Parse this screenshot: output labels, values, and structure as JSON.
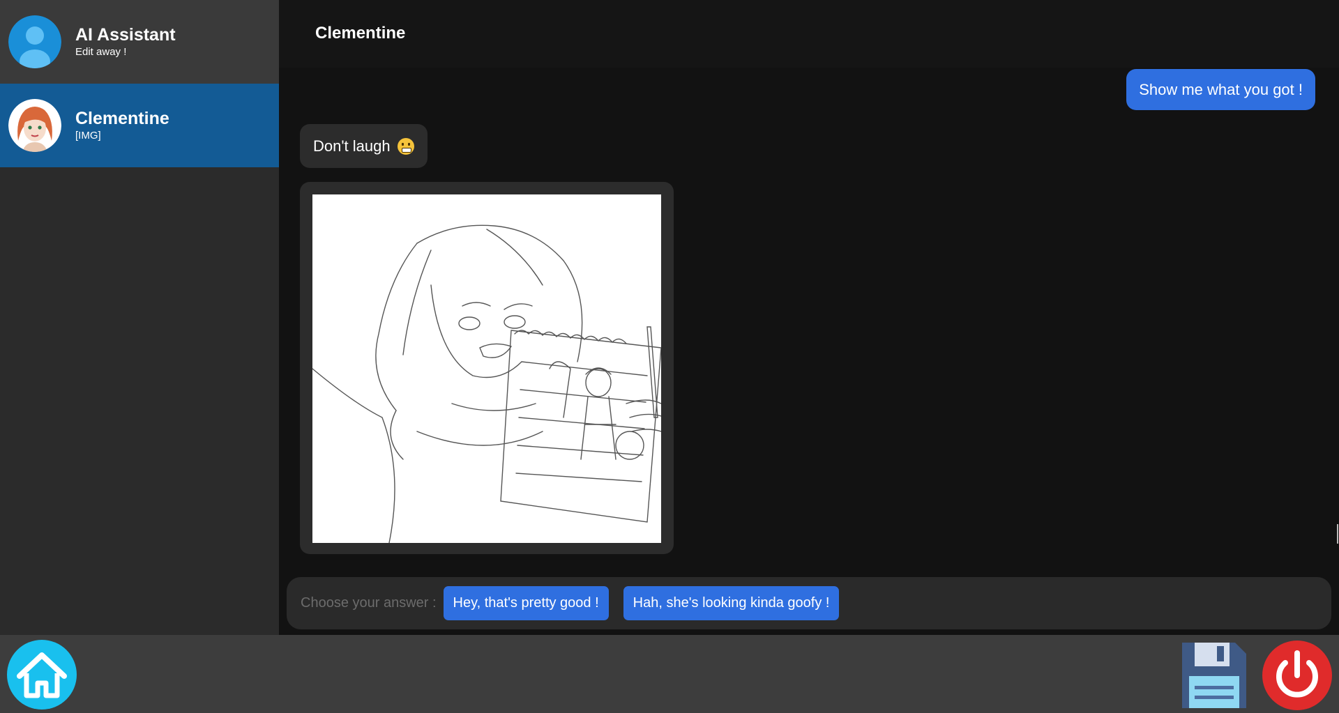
{
  "sidebar": {
    "contacts": [
      {
        "name": "AI Assistant",
        "subtitle": "Edit away !",
        "avatar_icon": "user-silhouette-icon"
      },
      {
        "name": "Clementine",
        "subtitle": "[IMG]",
        "avatar_icon": "clementine-avatar",
        "selected": true
      }
    ]
  },
  "chat": {
    "title": "Clementine",
    "messages": [
      {
        "from": "user",
        "text": "Show me what you got !"
      },
      {
        "from": "bot",
        "text": "Don't laugh",
        "emoji": "grimacing-face-icon"
      },
      {
        "from": "bot",
        "type": "image",
        "image": "sketch-drawing"
      }
    ]
  },
  "answers": {
    "prompt": "Choose your answer :",
    "options": [
      "Hey, that's pretty good !",
      "Hah, she's looking kinda goofy !"
    ]
  },
  "footer": {
    "home_icon": "home-icon",
    "save_icon": "floppy-disk-icon",
    "power_icon": "power-icon"
  },
  "colors": {
    "accent_blue": "#2f6fe0",
    "selected_contact": "#135b95",
    "home": "#19c0ee",
    "power": "#e02b2b"
  }
}
